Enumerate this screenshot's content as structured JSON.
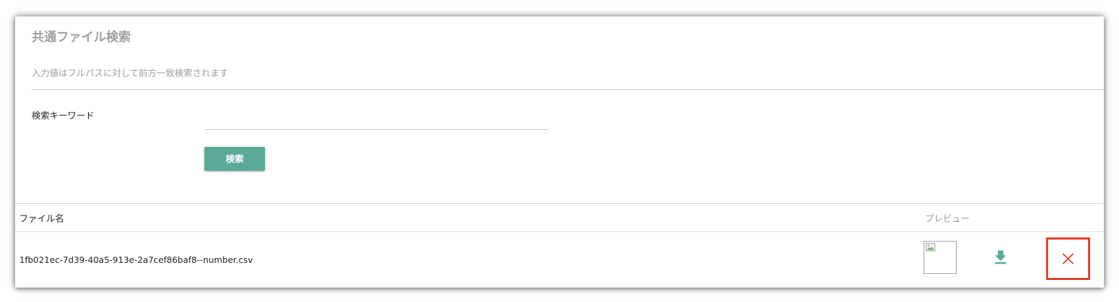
{
  "header": {
    "title": "共通ファイル検索",
    "subtitle": "入力値はフルパスに対して前方一致検索されます"
  },
  "search": {
    "keyword_label": "検索キーワード",
    "keyword_value": "",
    "keyword_placeholder": "",
    "button_label": "検索"
  },
  "table": {
    "columns": [
      "ファイル名",
      "プレビュー"
    ],
    "rows": [
      {
        "filename": "1fb021ec-7d39-40a5-913e-2a7cef86baf8--number.csv",
        "preview": "broken-image-icon",
        "actions": [
          "download-icon",
          "close-icon"
        ]
      }
    ]
  },
  "colors": {
    "accent": "#5aaa97",
    "highlight": "#e53d2b",
    "muted_text": "#9e9e9e"
  }
}
